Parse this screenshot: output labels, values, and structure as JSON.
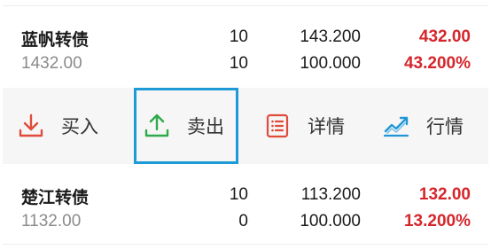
{
  "positions": [
    {
      "name": "蓝帆转债",
      "cost": "1432.00",
      "qty_top": "10",
      "qty_bottom": "10",
      "price_top": "143.200",
      "price_bottom": "100.000",
      "profit": "432.00",
      "profit_pct": "43.200%"
    },
    {
      "name": "楚江转债",
      "cost": "1132.00",
      "qty_top": "10",
      "qty_bottom": "0",
      "price_top": "113.200",
      "price_bottom": "100.000",
      "profit": "132.00",
      "profit_pct": "13.200%"
    }
  ],
  "actions": {
    "buy": {
      "label": "买入",
      "icon": "download-icon"
    },
    "sell": {
      "label": "卖出",
      "icon": "upload-icon"
    },
    "detail": {
      "label": "详情",
      "icon": "list-icon"
    },
    "quote": {
      "label": "行情",
      "icon": "trend-chart-icon"
    }
  },
  "colors": {
    "profit": "#d5262b",
    "buy_icon": "#e04b3a",
    "sell_icon": "#2eaa4a",
    "detail_icon": "#e04b3a",
    "quote_icon": "#2196d6",
    "selection_border": "#1e9ad6"
  }
}
